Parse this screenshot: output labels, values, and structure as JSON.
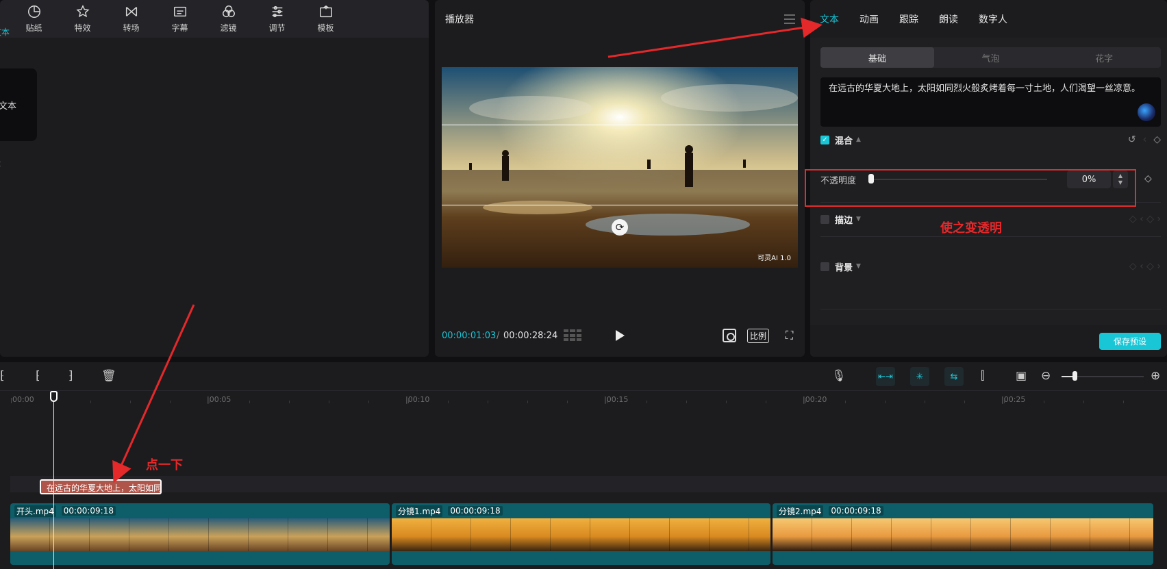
{
  "media": {
    "tools": [
      {
        "label": "文本",
        "icon": "text-icon"
      },
      {
        "label": "贴纸",
        "icon": "sticker-icon"
      },
      {
        "label": "特效",
        "icon": "effects-icon"
      },
      {
        "label": "转场",
        "icon": "transition-icon"
      },
      {
        "label": "字幕",
        "icon": "subtitle-icon"
      },
      {
        "label": "滤镜",
        "icon": "filter-icon"
      },
      {
        "label": "调节",
        "icon": "adjust-icon"
      },
      {
        "label": "模板",
        "icon": "template-icon"
      }
    ],
    "card_label": "文本"
  },
  "player": {
    "title": "播放器",
    "watermark": "可灵AI 1.0",
    "current_time": "00:00:01:03",
    "separator": "/",
    "total_time": "00:00:28:24",
    "ratio_label": "比例"
  },
  "inspector": {
    "tabs": [
      "文本",
      "动画",
      "跟踪",
      "朗读",
      "数字人"
    ],
    "active_tab": 0,
    "segments": [
      "基础",
      "气泡",
      "花字"
    ],
    "active_segment": 0,
    "text_content": "在远古的华夏大地上，太阳如同烈火般炙烤着每一寸土地，人们渴望一丝凉意。",
    "blend": {
      "label": "混合",
      "checked": true
    },
    "opacity": {
      "label": "不透明度",
      "value_text": "0%",
      "value": 0
    },
    "stroke": {
      "label": "描边",
      "checked": false
    },
    "background": {
      "label": "背景",
      "checked": false
    },
    "save_preset": "保存预设"
  },
  "annotations": {
    "make_transparent": "使之变透明",
    "click_once": "点一下"
  },
  "timeline": {
    "ruler_labels": [
      "00:00",
      "|00:05",
      "|00:10",
      "|00:15",
      "|00:20",
      "|00:25"
    ],
    "text_clip_label": "在远古的华夏大地上，太阳如同",
    "clips": [
      {
        "name": "开头.mp4",
        "duration": "00:00:09:18"
      },
      {
        "name": "分镜1.mp4",
        "duration": "00:00:09:18"
      },
      {
        "name": "分镜2.mp4",
        "duration": "00:00:09:18"
      }
    ]
  },
  "colors": {
    "accent": "#19c6d6",
    "annotation_red": "#e5282a",
    "text_clip": "#b0554a",
    "video_clip": "#0d5e68"
  }
}
